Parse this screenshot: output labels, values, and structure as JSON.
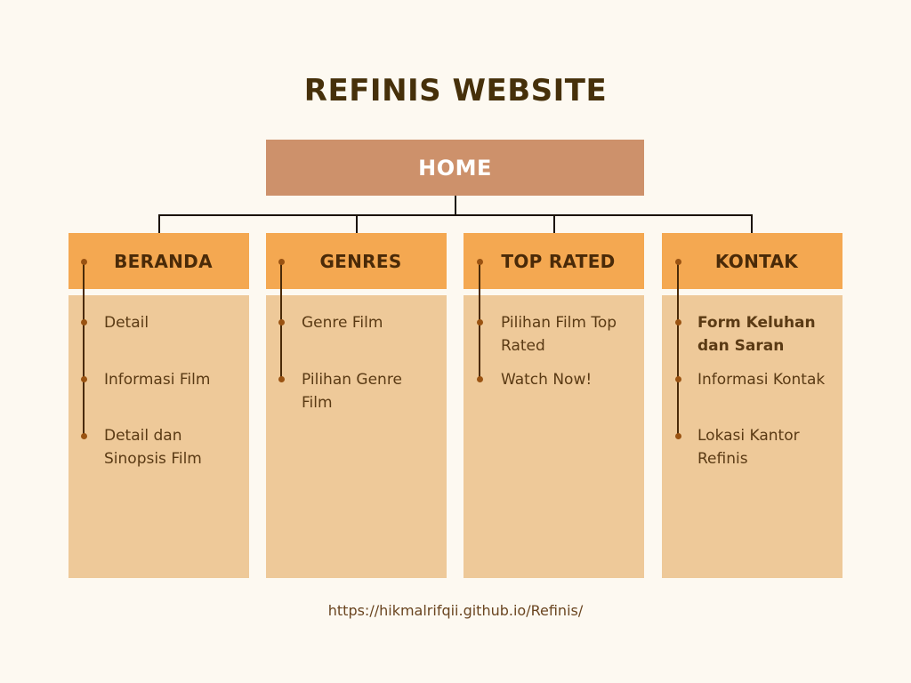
{
  "title": "REFINIS WEBSITE",
  "home": "HOME",
  "columns": [
    {
      "header": "BERANDA",
      "items": [
        "Detail",
        "Informasi Film",
        "Detail dan Sinopsis Film"
      ]
    },
    {
      "header": "GENRES",
      "items": [
        "Genre Film",
        "Pilihan Genre Film"
      ]
    },
    {
      "header": "TOP RATED",
      "items": [
        "Pilihan Film Top Rated",
        "Watch Now!"
      ]
    },
    {
      "header": "KONTAK",
      "items": [
        "Form Keluhan dan Saran",
        "Informasi Kontak",
        "Lokasi Kantor Refinis"
      ]
    }
  ],
  "footer": "https://hikmalrifqii.github.io/Refinis/",
  "colors": {
    "background": "#fdf9f1",
    "home_box": "#cd916b",
    "column_header": "#f4a851",
    "column_body": "#eec999",
    "title_text": "#46300a",
    "bullet": "#9a5312"
  }
}
